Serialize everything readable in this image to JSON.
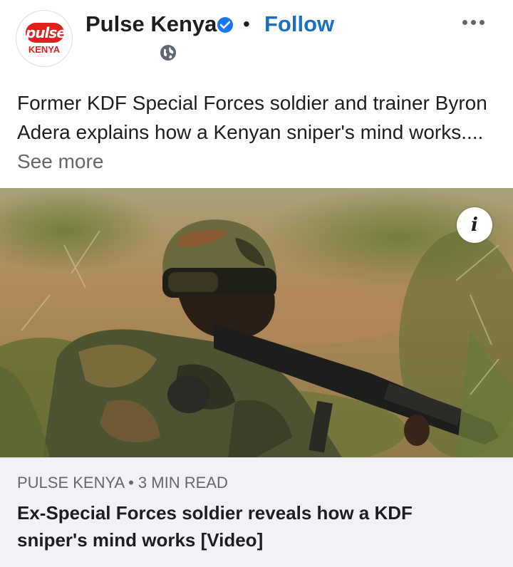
{
  "header": {
    "avatar_logo": "pulse",
    "avatar_sub": "KENYA",
    "page_name": "Pulse Kenya",
    "separator": "•",
    "follow_label": "Follow",
    "verified_icon": "verified-check-icon",
    "privacy_icon": "globe-icon",
    "more_icon": "more-options-icon"
  },
  "post": {
    "text": "Former KDF Special Forces soldier and trainer Byron Adera explains how a Kenyan sniper's mind works....",
    "see_more": "See more"
  },
  "link_preview": {
    "info_label": "i",
    "source": "PULSE KENYA • 3 MIN READ",
    "headline": "Ex-Special Forces soldier reveals how a KDF sniper's mind works [Video]"
  },
  "colors": {
    "brand_red": "#e0201f",
    "follow_blue": "#1a70c9",
    "verified_blue": "#1877f2",
    "footer_bg": "#f0f2f5"
  }
}
